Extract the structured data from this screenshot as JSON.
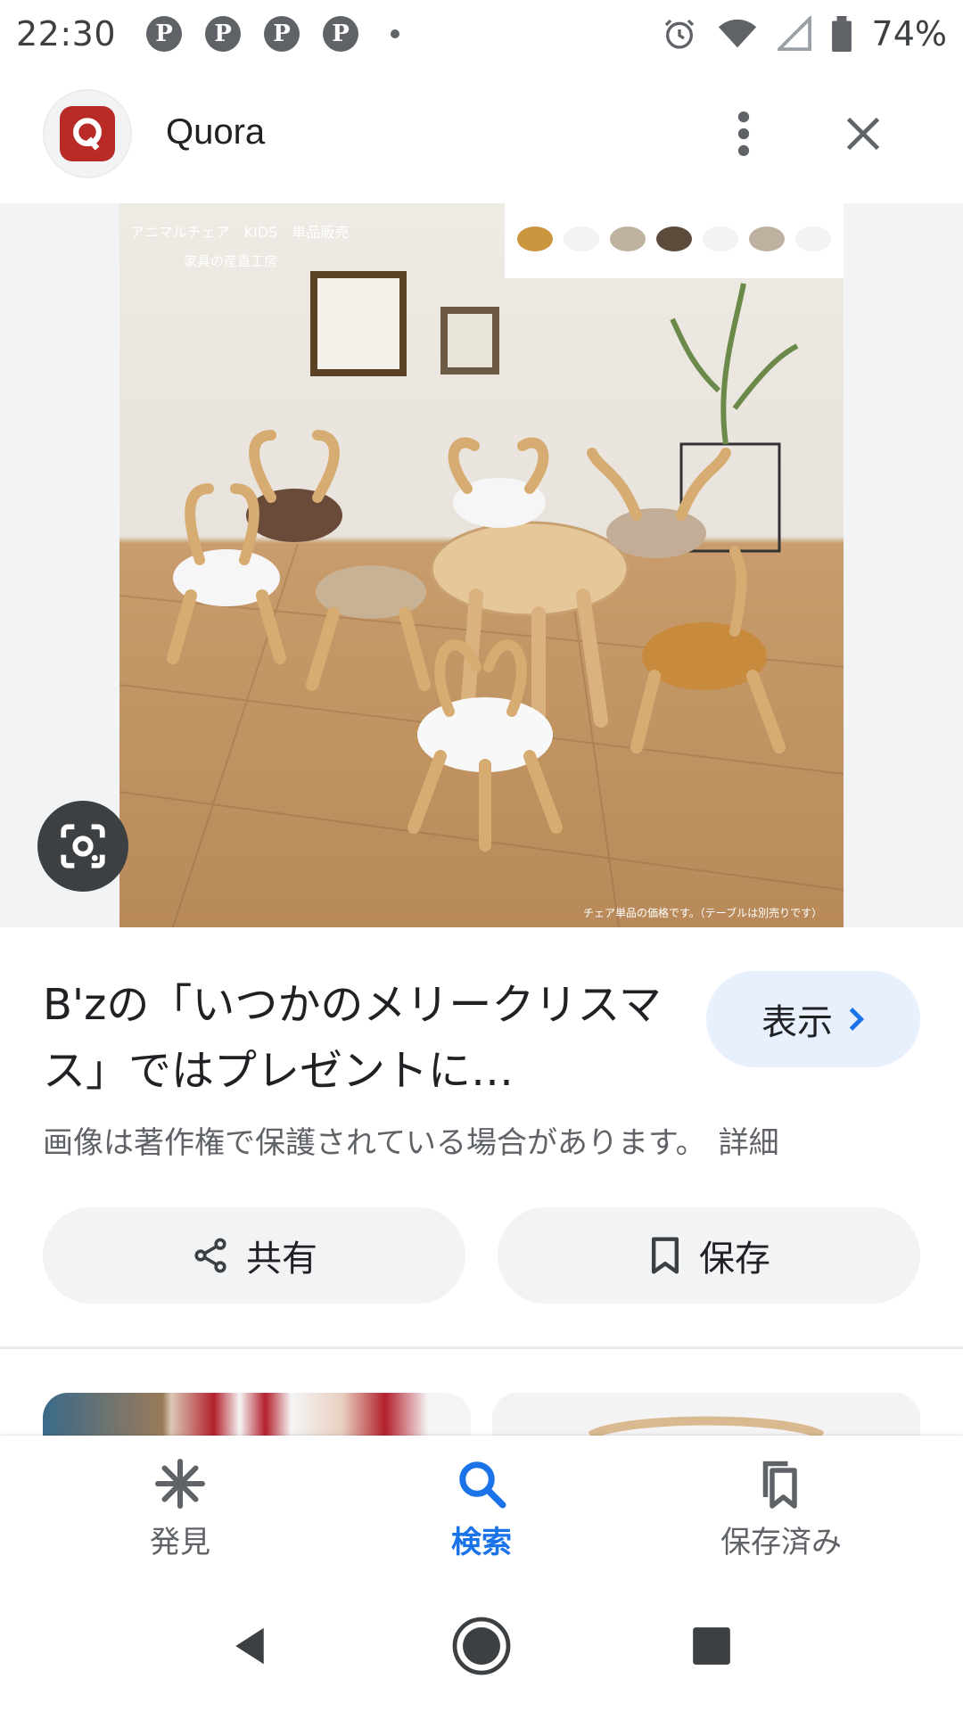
{
  "status_bar": {
    "time": "22:30",
    "notification_icons": [
      "pinterest-icon",
      "pinterest-icon",
      "pinterest-icon",
      "pinterest-icon"
    ],
    "battery": "74%"
  },
  "header": {
    "site_name": "Quora",
    "logo_letter": "Q"
  },
  "image_overlay": {
    "caption_top_1": "アニマルチェア　KIDS　単品販売",
    "caption_top_2": "家具の産直工房",
    "caption_bottom": "チェア単品の価格です。（テーブルは別売りです）"
  },
  "result": {
    "title": "B'zの「いつかのメリークリスマス」ではプレゼントに…",
    "view_label": "表示",
    "copyright_text": "画像は著作権で保護されている場合があります。",
    "details_link": "詳細"
  },
  "actions": {
    "share_label": "共有",
    "save_label": "保存"
  },
  "bottom_nav": {
    "items": [
      {
        "label": "発見",
        "icon": "asterisk-icon",
        "active": false
      },
      {
        "label": "検索",
        "icon": "search-icon",
        "active": true
      },
      {
        "label": "保存済み",
        "icon": "bookmarks-icon",
        "active": false
      }
    ]
  },
  "colors": {
    "accent": "#1a73e8",
    "view_button_bg": "#e8f0fe",
    "action_button_bg": "#f1f3f4",
    "quora_brand": "#b92b27"
  }
}
